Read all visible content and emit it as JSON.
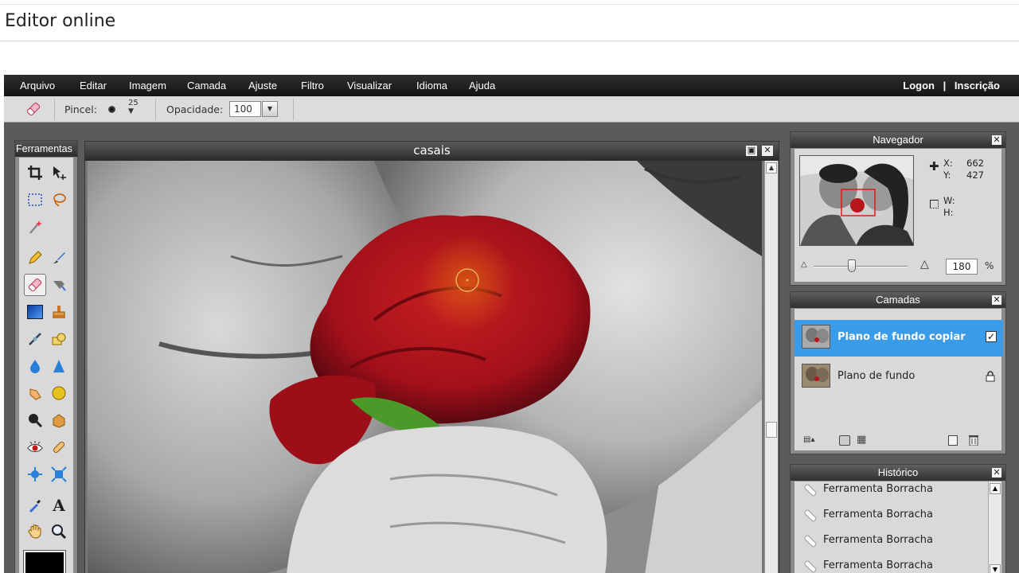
{
  "page": {
    "title": "Editor online"
  },
  "menubar": {
    "items": [
      "Arquivo",
      "Editar",
      "Imagem",
      "Camada",
      "Ajuste",
      "Filtro",
      "Visualizar",
      "Idioma",
      "Ajuda"
    ],
    "logon": "Logon",
    "separator": "|",
    "signup": "Inscrição"
  },
  "options": {
    "brush_label": "Pincel:",
    "brush_size": "25",
    "opacity_label": "Opacidade:",
    "opacity_value": "100"
  },
  "tools": {
    "title": "Ferramentas",
    "text_tool_glyph": "A",
    "foreground_color": "#000000"
  },
  "canvas": {
    "title": "casais"
  },
  "navigator": {
    "title": "Navegador",
    "x_label": "X:",
    "x_value": "662",
    "y_label": "Y:",
    "y_value": "427",
    "w_label": "W:",
    "h_label": "H:",
    "zoom_value": "180",
    "zoom_unit": "%"
  },
  "layers": {
    "title": "Camadas",
    "items": [
      {
        "name": "Plano de fundo copiar",
        "selected": true
      },
      {
        "name": "Plano de fundo",
        "selected": false
      }
    ]
  },
  "history": {
    "title": "Histórico",
    "items": [
      "Ferramenta Borracha",
      "Ferramenta Borracha",
      "Ferramenta Borracha",
      "Ferramenta Borracha"
    ]
  },
  "colors": {
    "selection_blue": "#3a9be8",
    "rose_red": "#b8151c",
    "menubar_bg": "#1c1c1c"
  }
}
